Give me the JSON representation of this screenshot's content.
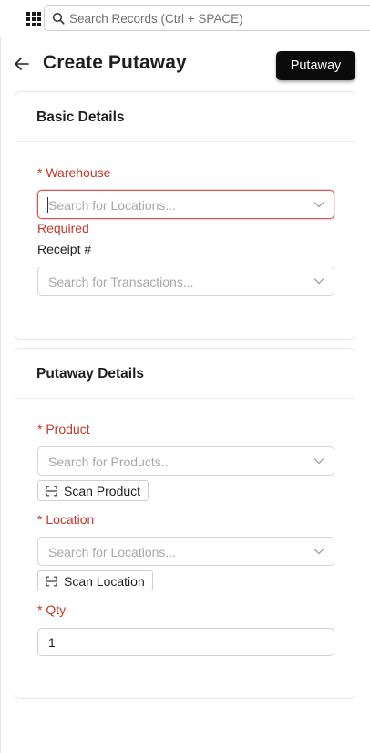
{
  "topbar": {
    "search_placeholder": "Search Records (Ctrl + SPACE)"
  },
  "header": {
    "title": "Create Putaway",
    "primary_button": "Putaway"
  },
  "basic_details": {
    "heading": "Basic Details",
    "warehouse": {
      "label": "* Warehouse",
      "placeholder": "Search for Locations...",
      "error": "Required"
    },
    "receipt": {
      "label": "Receipt #",
      "placeholder": "Search for Transactions..."
    }
  },
  "putaway_details": {
    "heading": "Putaway Details",
    "product": {
      "label": "* Product",
      "placeholder": "Search for Products...",
      "scan_button": "Scan Product"
    },
    "location": {
      "label": "* Location",
      "placeholder": "Search for Locations...",
      "scan_button": "Scan Location"
    },
    "qty": {
      "label": "* Qty",
      "value": "1"
    }
  },
  "colors": {
    "required": "#c0392b",
    "primary_button_bg": "#0b0b0b",
    "border": "#d4d4d4"
  }
}
